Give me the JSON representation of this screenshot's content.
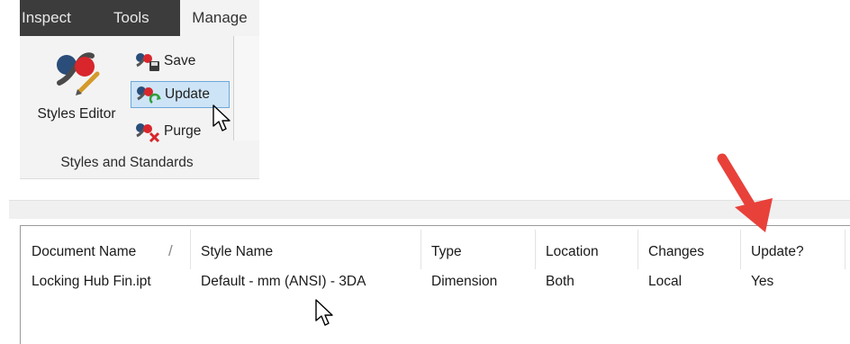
{
  "ribbon": {
    "tabs": [
      {
        "label": "Inspect"
      },
      {
        "label": "Tools"
      },
      {
        "label": "Manage"
      }
    ],
    "styles_editor_label": "Styles Editor",
    "save_label": "Save",
    "update_label": "Update",
    "purge_label": "Purge",
    "group_label": "Styles and Standards"
  },
  "table": {
    "columns": [
      "Document Name",
      "Style Name",
      "Type",
      "Location",
      "Changes",
      "Update?"
    ],
    "rows": [
      {
        "document_name": "Locking Hub Fin.ipt",
        "style_name": "Default - mm (ANSI) - 3DA",
        "type": "Dimension",
        "location": "Both",
        "changes": "Local",
        "update": "Yes"
      }
    ]
  },
  "colors": {
    "tab_bar": "#3c3c3c",
    "ribbon_panel": "#f3f3f3",
    "update_highlight": "#cde4f7",
    "annotation_arrow": "#e8413a"
  }
}
